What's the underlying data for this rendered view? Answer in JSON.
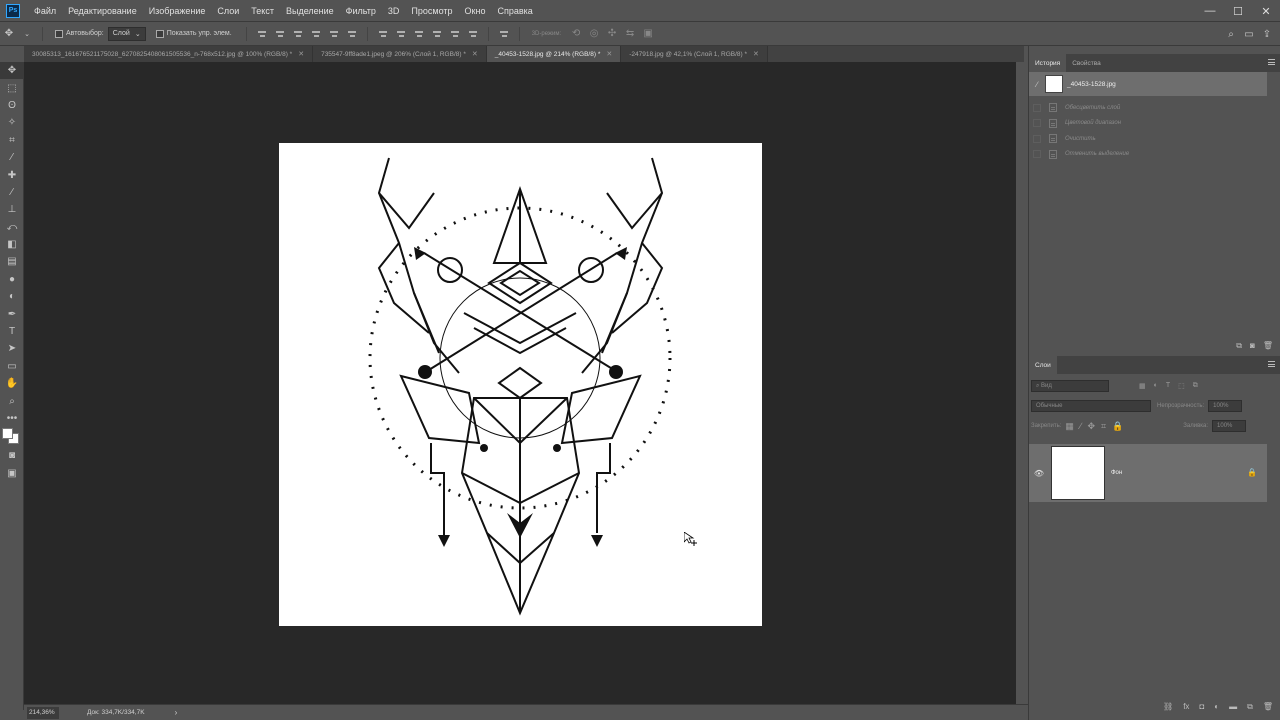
{
  "app": {
    "logo": "Ps"
  },
  "menu": [
    "Файл",
    "Редактирование",
    "Изображение",
    "Слои",
    "Текст",
    "Выделение",
    "Фильтр",
    "3D",
    "Просмотр",
    "Окно",
    "Справка"
  ],
  "window_controls": [
    "—",
    "☐",
    "✕"
  ],
  "options": {
    "autoselect_label": "Автовыбор:",
    "autoselect_value": "Слой",
    "show_transform_label": "Показать упр. элем.",
    "mode_3d": "3D-режим:"
  },
  "tabs": [
    {
      "label": "30085313_1616765211750​28_6270825408061505536_n-768x512.jpg @ 100% (RGB/8) *",
      "active": false
    },
    {
      "label": "735547-9ff8ade1.jpeg @ 206% (Слой 1, RGB/8) *",
      "active": false
    },
    {
      "label": "_40453-1528.jpg @ 214% (RGB/8) *",
      "active": true
    },
    {
      "label": "-247918.jpg @ 42,1% (Слой 1, RGB/8) *",
      "active": false
    }
  ],
  "status": {
    "zoom": "214,36%",
    "doc_size": "Док: 334,7K/334,7K",
    "arrow": "›"
  },
  "history": {
    "tabs": [
      "История",
      "Свойства"
    ],
    "snapshot": "_40453-1528.jpg",
    "items": [
      "Обесцветить слой",
      "Цветовой диапазон",
      "Очистить",
      "Отменить выделение"
    ]
  },
  "layers": {
    "tab": "Слои",
    "search_placeholder": "Вид",
    "blend_mode": "Обычные",
    "opacity_label": "Непрозрачность:",
    "opacity_value": "100%",
    "lock_label": "Закрепить:",
    "fill_label": "Заливка:",
    "fill_value": "100%",
    "layer_name": "Фон"
  },
  "colors": {
    "accent": "#31a8ff",
    "canvas_bg": "#282828",
    "ui_bg": "#535353",
    "selected": "#6e6e6e"
  }
}
